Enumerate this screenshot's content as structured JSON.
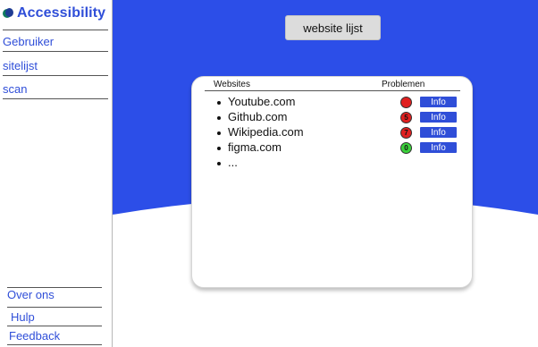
{
  "sidebar": {
    "logo_text": "Accessibility",
    "nav": [
      {
        "label": "Gebruiker"
      },
      {
        "label": "sitelijst"
      },
      {
        "label": "scan"
      }
    ],
    "footer": [
      {
        "label": "Over ons"
      },
      {
        "label": "Hulp"
      },
      {
        "label": "Feedback"
      }
    ]
  },
  "header": {
    "button_label": "website lijst"
  },
  "table": {
    "col_websites": "Websites",
    "col_problems": "Problemen",
    "rows": [
      {
        "site": "Youtube.com",
        "problems": "",
        "status_color": "#e02020",
        "info": "Info"
      },
      {
        "site": "Github.com",
        "problems": "5",
        "status_color": "#e02020",
        "info": "Info"
      },
      {
        "site": "Wikipedia.com",
        "problems": "7",
        "status_color": "#e02020",
        "info": "Info"
      },
      {
        "site": "figma.com",
        "problems": "0",
        "status_color": "#3ad13a",
        "info": "Info"
      },
      {
        "site": "...",
        "problems": null,
        "status_color": null,
        "info": null
      }
    ]
  },
  "colors": {
    "accent": "#2f4ed8",
    "background_blue": "#2c4ee8"
  }
}
